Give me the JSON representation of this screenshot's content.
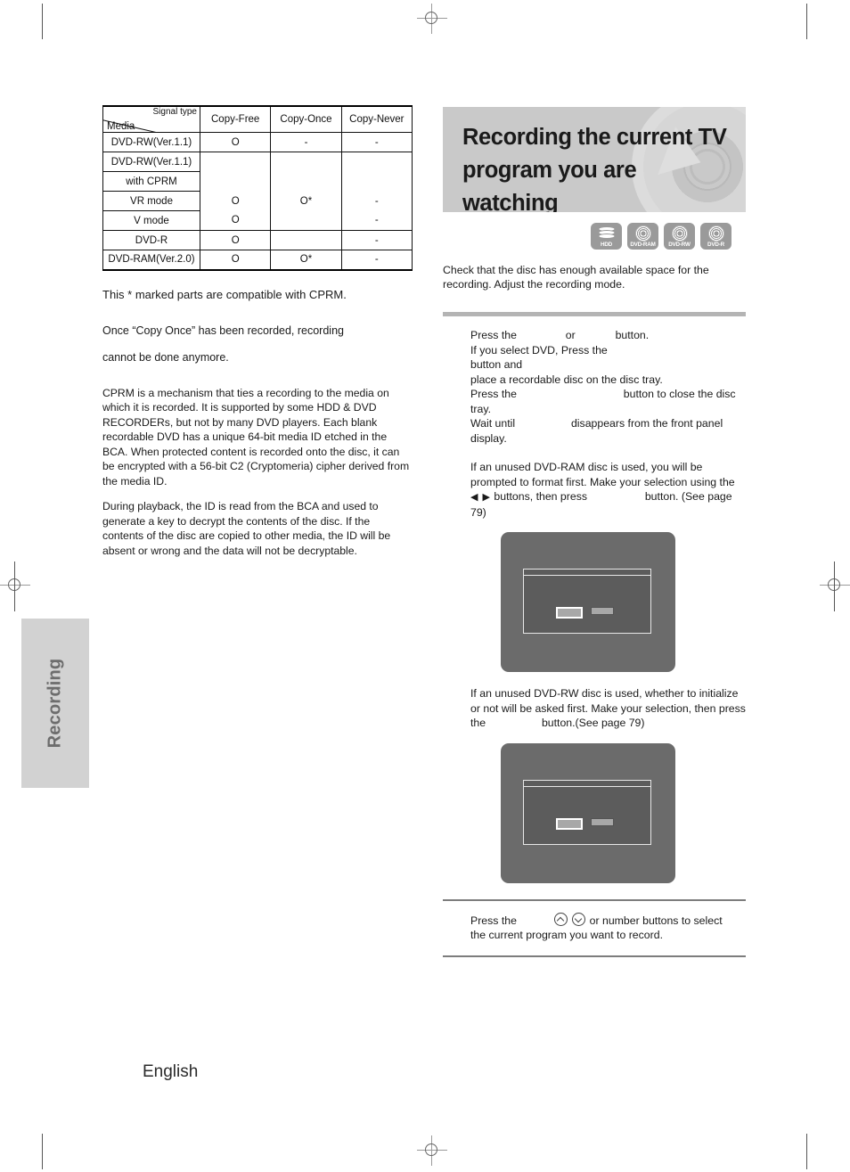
{
  "page": {
    "footer_language": "English",
    "side_tab_label": "Recording"
  },
  "compat_table": {
    "corner_header": {
      "signal_type": "Signal type",
      "media": "Media"
    },
    "columns": [
      "Copy-Free",
      "Copy-Once",
      "Copy-Never"
    ],
    "rows": [
      {
        "media": "DVD-RW(Ver.1.1)",
        "copy_free": "O",
        "copy_once": "-",
        "copy_never": "-"
      },
      {
        "media": "DVD-RW(Ver.1.1)",
        "copy_free": "",
        "copy_once": "",
        "copy_never": ""
      },
      {
        "media": "with CPRM",
        "copy_free": "",
        "copy_once": "",
        "copy_never": ""
      },
      {
        "media": "VR mode",
        "copy_free": "O",
        "copy_once": "O*",
        "copy_never": "-"
      },
      {
        "media": "V mode",
        "copy_free": "O",
        "copy_once": "",
        "copy_never": "-"
      },
      {
        "media": "DVD-R",
        "copy_free": "O",
        "copy_once": "",
        "copy_never": "-"
      },
      {
        "media": "DVD-RAM(Ver.2.0)",
        "copy_free": "O",
        "copy_once": "O*",
        "copy_never": "-"
      }
    ]
  },
  "left_column": {
    "note_asterisk": "This * marked parts are compatible with CPRM.",
    "note_copy_once_line1": "Once “Copy Once” has been recorded, recording",
    "note_copy_once_line2": "cannot be done anymore.",
    "cprm_paragraph": "CPRM is a mechanism that ties a recording to the media on which it is recorded. It is supported by some HDD & DVD RECORDERs, but not by many DVD players. Each blank recordable DVD has a unique 64-bit media ID etched in the BCA. When protected content is recorded onto the disc, it can be encrypted with a 56-bit C2 (Cryptomeria) cipher derived from the media ID.",
    "playback_paragraph": "During playback, the ID is read from the BCA and used to generate a key to decrypt the contents of the disc. If the contents of the disc are copied to other media, the ID will be absent or wrong and the data will not be decryptable."
  },
  "right_column": {
    "title_line1": "Recording the current TV",
    "title_line2": "program you are watching",
    "media_badges": [
      {
        "label": "HDD",
        "icon": "hdd-stack-icon"
      },
      {
        "label": "DVD-RAM",
        "icon": "disc-icon"
      },
      {
        "label": "DVD-RW",
        "icon": "disc-icon"
      },
      {
        "label": "DVD-R",
        "icon": "disc-icon"
      }
    ],
    "intro": "Check that the disc has enough available space for the recording. Adjust the recording mode.",
    "step1": {
      "line1_a": "Press the",
      "line1_or": "or",
      "line1_b": "button.",
      "line2_a": "If you select DVD, Press the",
      "line2_b": "button and",
      "line3": "place a recordable disc on the disc tray.",
      "line4_a": "Press the",
      "line4_b": "button to close the disc tray.",
      "line5_a": "Wait until",
      "line5_b": "disappears from the front panel display."
    },
    "dvdram_note": {
      "line1": "If an unused DVD-RAM disc is used, you will be",
      "line2": "prompted to format first. Make your selection using the",
      "line3_arrows": "◀ ▶",
      "line3_a": "buttons, then press",
      "line3_b": "button. (See page 79)"
    },
    "dvdrw_note": {
      "line1": "If an unused DVD-RW disc is used, whether to initialize",
      "line2": "or not will be asked first. Make your selection, then press",
      "line3_a": "the",
      "line3_b": "button.(See page 79)"
    },
    "step2": {
      "line1_a": "Press the",
      "line1_b": "or number buttons to select",
      "line2": "the current program you want to record."
    }
  }
}
